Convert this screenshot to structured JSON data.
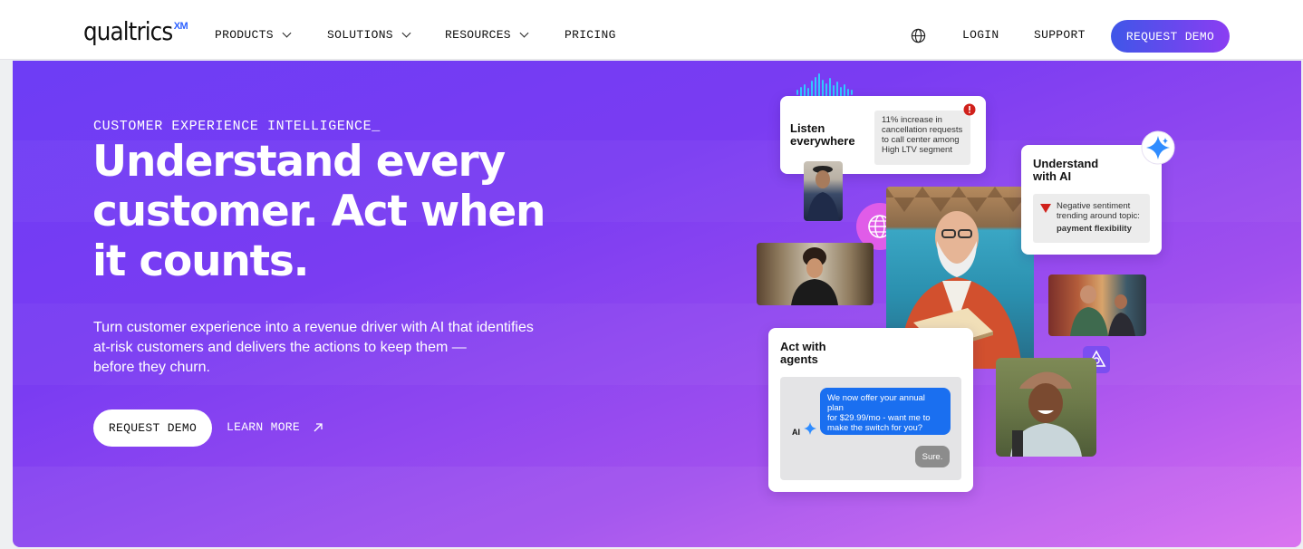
{
  "nav": {
    "logo_text": "qualtrics",
    "logo_sup": "XM",
    "items": [
      {
        "label": "PRODUCTS",
        "dropdown": true
      },
      {
        "label": "SOLUTIONS",
        "dropdown": true
      },
      {
        "label": "RESOURCES",
        "dropdown": true
      },
      {
        "label": "PRICING",
        "dropdown": false
      }
    ],
    "login": "LOGIN",
    "support": "SUPPORT",
    "cta": "REQUEST DEMO",
    "icons": {
      "language": "globe-icon",
      "dropdown": "chevron-down-icon"
    }
  },
  "hero": {
    "eyebrow": "CUSTOMER EXPERIENCE INTELLIGENCE_",
    "headline_lines": [
      "Understand every",
      "customer. Act when",
      "it counts."
    ],
    "subtext_lines": [
      "Turn customer experience into a revenue driver with AI that identifies",
      "at-risk customers and delivers the actions to keep them —",
      "before they churn."
    ],
    "primary_cta": "REQUEST DEMO",
    "secondary_cta": "LEARN MORE",
    "secondary_icon": "arrow-up-right-icon"
  },
  "collage": {
    "listen": {
      "title_lines": [
        "Listen",
        "everywhere"
      ],
      "note_lines": [
        "11% increase in",
        "cancellation requests",
        "to call center among",
        "High LTV segment"
      ]
    },
    "understand": {
      "title_lines": [
        "Understand",
        "with AI"
      ],
      "note_lines": [
        "Negative sentiment",
        "trending around topic:"
      ],
      "note_bold": "payment flexibility"
    },
    "act": {
      "title_lines": [
        "Act with",
        "agents"
      ],
      "ai_label": "AI",
      "message_lines": [
        "We now offer your annual plan",
        "for $29.99/mo - want me to",
        "make the switch for you?"
      ],
      "reply": "Sure."
    }
  },
  "colors": {
    "brand_blue": "#2f63ff",
    "hero_start": "#6d3df5",
    "hero_end": "#d86ef0",
    "chat_bubble": "#1a6ff0",
    "alert_red": "#d0211b"
  }
}
